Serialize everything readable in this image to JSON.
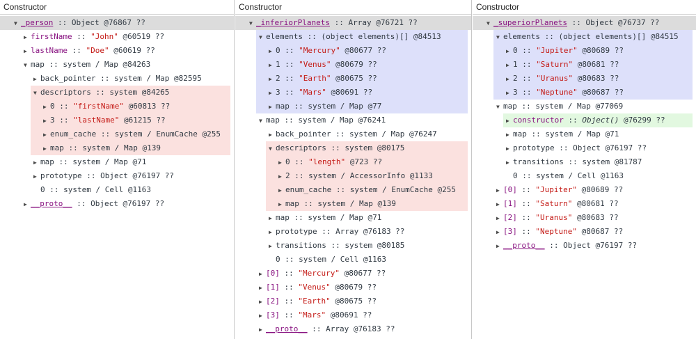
{
  "colors": {
    "name": "#881280",
    "string": "#c41a16",
    "text": "#303942",
    "root_highlight": "#dcdcdc",
    "elements_highlight": "#dde0fa",
    "descriptors_highlight": "#fbe1df",
    "retainer_highlight": "#e2f8e0"
  },
  "panels": [
    {
      "header": "Constructor",
      "rows": [
        {
          "indent": 2,
          "tri": "▼",
          "name": "_person",
          "nu": true,
          "sep": " :: ",
          "rest": "Object @76867 ??",
          "root": true
        },
        {
          "indent": 3,
          "tri": "▶",
          "name": "firstName",
          "sep": " :: ",
          "str": "\"John\"",
          "rest": " @60519 ??"
        },
        {
          "indent": 3,
          "tri": "▶",
          "name": "lastName",
          "sep": " :: ",
          "str": "\"Doe\"",
          "rest": " @60619 ??"
        },
        {
          "indent": 3,
          "tri": "▼",
          "plain": "map :: system / Map @84263"
        },
        {
          "indent": 4,
          "tri": "▶",
          "plain": "back_pointer :: system / Map @82595"
        },
        {
          "indent": 4,
          "tri": "▼",
          "plain": "descriptors :: system @84265"
        },
        {
          "indent": 5,
          "tri": "▶",
          "plain": "0 :: ",
          "str": "\"firstName\"",
          "rest": " @60813 ??"
        },
        {
          "indent": 5,
          "tri": "▶",
          "plain": "3 :: ",
          "str": "\"lastName\"",
          "rest": " @61215 ??"
        },
        {
          "indent": 5,
          "tri": "▶",
          "plain": "enum_cache :: system / EnumCache @255"
        },
        {
          "indent": 5,
          "tri": "▶",
          "plain": "map :: system / Map @139"
        },
        {
          "indent": 4,
          "tri": "▶",
          "plain": "map :: system / Map @71"
        },
        {
          "indent": 4,
          "tri": "▶",
          "plain": "prototype :: Object @76197 ??"
        },
        {
          "indent": 4,
          "tri": "",
          "plain": "0 :: system / Cell @1163"
        },
        {
          "indent": 3,
          "tri": "▶",
          "name": "__proto__",
          "nu": true,
          "sep": " :: ",
          "rest": "Object @76197 ??"
        }
      ],
      "boxes": [
        {
          "cls": "hl-gray",
          "from": 0,
          "to": 0
        },
        {
          "cls": "hl-pink",
          "from": 5,
          "to": 9,
          "indent": 4
        }
      ]
    },
    {
      "header": "Constructor",
      "rows": [
        {
          "indent": 2,
          "tri": "▼",
          "name": "_inferiorPlanets",
          "nu": true,
          "sep": " :: ",
          "rest": "Array @76721 ??",
          "root": true
        },
        {
          "indent": 3,
          "tri": "▼",
          "plain": "elements :: (object elements)[] @84513"
        },
        {
          "indent": 4,
          "tri": "▶",
          "plain": "0 :: ",
          "str": "\"Mercury\"",
          "rest": " @80677 ??"
        },
        {
          "indent": 4,
          "tri": "▶",
          "plain": "1 :: ",
          "str": "\"Venus\"",
          "rest": " @80679 ??"
        },
        {
          "indent": 4,
          "tri": "▶",
          "plain": "2 :: ",
          "str": "\"Earth\"",
          "rest": " @80675 ??"
        },
        {
          "indent": 4,
          "tri": "▶",
          "plain": "3 :: ",
          "str": "\"Mars\"",
          "rest": " @80691 ??"
        },
        {
          "indent": 4,
          "tri": "▶",
          "plain": "map :: system / Map @77"
        },
        {
          "indent": 3,
          "tri": "▼",
          "plain": "map :: system / Map @76241"
        },
        {
          "indent": 4,
          "tri": "▶",
          "plain": "back_pointer :: system / Map @76247"
        },
        {
          "indent": 4,
          "tri": "▼",
          "plain": "descriptors :: system @80175"
        },
        {
          "indent": 5,
          "tri": "▶",
          "plain": "0 :: ",
          "str": "\"length\"",
          "rest": " @723 ??"
        },
        {
          "indent": 5,
          "tri": "▶",
          "plain": "2 :: system / AccessorInfo @1133"
        },
        {
          "indent": 5,
          "tri": "▶",
          "plain": "enum_cache :: system / EnumCache @255"
        },
        {
          "indent": 5,
          "tri": "▶",
          "plain": "map :: system / Map @139"
        },
        {
          "indent": 4,
          "tri": "▶",
          "plain": "map :: system / Map @71"
        },
        {
          "indent": 4,
          "tri": "▶",
          "plain": "prototype :: Array @76183 ??"
        },
        {
          "indent": 4,
          "tri": "▶",
          "plain": "transitions :: system @80185"
        },
        {
          "indent": 4,
          "tri": "",
          "plain": "0 :: system / Cell @1163"
        },
        {
          "indent": 3,
          "tri": "▶",
          "name": "[0]",
          "sep": " :: ",
          "str": "\"Mercury\"",
          "rest": " @80677 ??"
        },
        {
          "indent": 3,
          "tri": "▶",
          "name": "[1]",
          "sep": " :: ",
          "str": "\"Venus\"",
          "rest": " @80679 ??"
        },
        {
          "indent": 3,
          "tri": "▶",
          "name": "[2]",
          "sep": " :: ",
          "str": "\"Earth\"",
          "rest": " @80675 ??"
        },
        {
          "indent": 3,
          "tri": "▶",
          "name": "[3]",
          "sep": " :: ",
          "str": "\"Mars\"",
          "rest": " @80691 ??"
        },
        {
          "indent": 3,
          "tri": "▶",
          "name": "__proto__",
          "nu": true,
          "sep": " :: ",
          "rest": "Array @76183 ??"
        }
      ],
      "boxes": [
        {
          "cls": "hl-gray",
          "from": 0,
          "to": 0
        },
        {
          "cls": "hl-blue",
          "from": 1,
          "to": 6,
          "indent": 3
        },
        {
          "cls": "hl-pink",
          "from": 9,
          "to": 13,
          "indent": 4
        }
      ]
    },
    {
      "header": "Constructor",
      "rows": [
        {
          "indent": 2,
          "tri": "▼",
          "name": "_superiorPlanets",
          "nu": true,
          "sep": " :: ",
          "rest": "Object @76737 ??",
          "root": true
        },
        {
          "indent": 3,
          "tri": "▼",
          "plain": "elements :: (object elements)[] @84515"
        },
        {
          "indent": 4,
          "tri": "▶",
          "plain": "0 :: ",
          "str": "\"Jupiter\"",
          "rest": " @80689 ??"
        },
        {
          "indent": 4,
          "tri": "▶",
          "plain": "1 :: ",
          "str": "\"Saturn\"",
          "rest": " @80681 ??"
        },
        {
          "indent": 4,
          "tri": "▶",
          "plain": "2 :: ",
          "str": "\"Uranus\"",
          "rest": " @80683 ??"
        },
        {
          "indent": 4,
          "tri": "▶",
          "plain": "3 :: ",
          "str": "\"Neptune\"",
          "rest": " @80687 ??"
        },
        {
          "indent": 3,
          "tri": "▼",
          "plain": "map :: system / Map @77069"
        },
        {
          "indent": 4,
          "tri": "▶",
          "name": "constructor",
          "sep": " :: ",
          "ital": "Object()",
          "rest": " @76299 ??"
        },
        {
          "indent": 4,
          "tri": "▶",
          "plain": "map :: system / Map @71"
        },
        {
          "indent": 4,
          "tri": "▶",
          "plain": "prototype :: Object @76197 ??"
        },
        {
          "indent": 4,
          "tri": "▶",
          "plain": "transitions :: system @81787"
        },
        {
          "indent": 4,
          "tri": "",
          "plain": "0 :: system / Cell @1163"
        },
        {
          "indent": 3,
          "tri": "▶",
          "name": "[0]",
          "sep": " :: ",
          "str": "\"Jupiter\"",
          "rest": " @80689 ??"
        },
        {
          "indent": 3,
          "tri": "▶",
          "name": "[1]",
          "sep": " :: ",
          "str": "\"Saturn\"",
          "rest": " @80681 ??"
        },
        {
          "indent": 3,
          "tri": "▶",
          "name": "[2]",
          "sep": " :: ",
          "str": "\"Uranus\"",
          "rest": " @80683 ??"
        },
        {
          "indent": 3,
          "tri": "▶",
          "name": "[3]",
          "sep": " :: ",
          "str": "\"Neptune\"",
          "rest": " @80687 ??"
        },
        {
          "indent": 3,
          "tri": "▶",
          "name": "__proto__",
          "nu": true,
          "sep": " :: ",
          "rest": "Object @76197 ??"
        }
      ],
      "boxes": [
        {
          "cls": "hl-gray",
          "from": 0,
          "to": 0
        },
        {
          "cls": "hl-blue",
          "from": 1,
          "to": 5,
          "indent": 3
        },
        {
          "cls": "hl-green",
          "from": 7,
          "to": 7,
          "indent": 4
        }
      ]
    }
  ]
}
